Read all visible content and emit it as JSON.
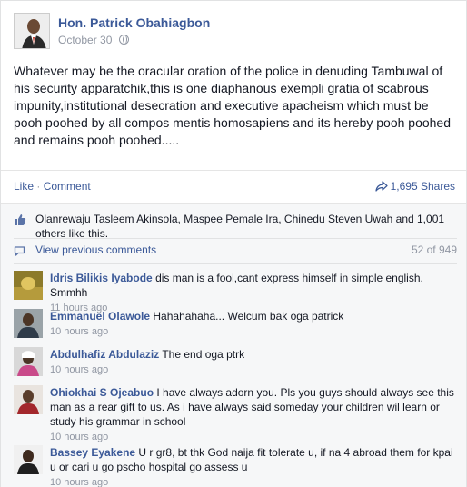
{
  "post": {
    "author": "Hon. Patrick Obahiagbon",
    "date": "October 30",
    "privacy_icon": "globe-icon",
    "text": "Whatever may be the oracular oration of the police in denuding Tambuwal of his security apparatchik,this is one diaphanous exempli gratia of scabrous impunity,institutional desecration and executive apacheism which must be pooh poohed by all compos mentis homosapiens and its hereby pooh poohed and remains pooh poohed....."
  },
  "actions": {
    "like": "Like",
    "separator": "·",
    "comment": "Comment",
    "shares": "1,695 Shares"
  },
  "likes": {
    "text": "Olanrewaju Tasleem Akinsola, Maspee Pemale Ira, Chinedu Steven Uwah and 1,001 others like this."
  },
  "comments_header": {
    "view_previous": "View previous comments",
    "count": "52 of 949"
  },
  "comments": [
    {
      "name": "Idris Bilikis Iyabode",
      "text": "dis man is a fool,cant express himself in simple english. Smmhh",
      "time": "11 hours ago"
    },
    {
      "name": "Emmanuel Olawole",
      "text": "Hahahahaha... Welcum bak oga patrick",
      "time": "10 hours ago"
    },
    {
      "name": "Abdulhafiz Abdulaziz",
      "text": "The end oga ptrk",
      "time": "10 hours ago"
    },
    {
      "name": "Ohiokhai S Ojeabuo",
      "text": "I have always adorn you. Pls you guys should always see this man as a rear gift to us. As i have always said someday your children wil learn or study his grammar in school",
      "time": "10 hours ago"
    },
    {
      "name": "Bassey Eyakene",
      "text": "U r gr8, bt thk God naija fit tolerate u, if na 4 abroad them for kpai u or cari u go pscho hospital go assess u",
      "time": "10 hours ago"
    }
  ],
  "colors": {
    "link": "#3b5998",
    "meta": "#9197a3",
    "feedback_bg": "#f6f7f8"
  }
}
